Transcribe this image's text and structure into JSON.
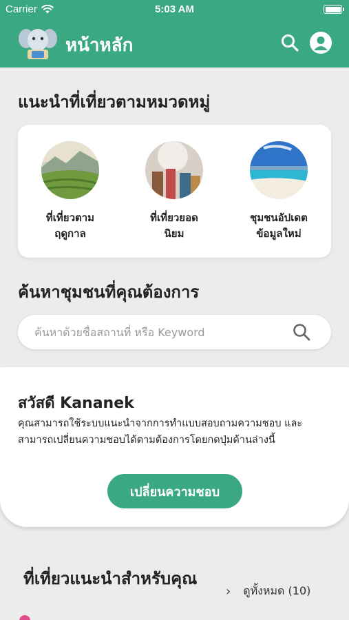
{
  "status_bar": {
    "carrier": "Carrier",
    "time": "5:03 AM"
  },
  "header": {
    "title": "หน้าหลัก",
    "logo_icon": "elephant-logo",
    "search_icon": "search-icon",
    "profile_icon": "user-icon"
  },
  "categories": {
    "title": "แนะนำที่เที่ยวตามหมวดหมู่",
    "items": [
      {
        "label_line1": "ที่เที่ยวตาม",
        "label_line2": "ฤดูกาล",
        "image": "mountain-landscape"
      },
      {
        "label_line1": "ที่เที่ยวยอด",
        "label_line2": "นิยม",
        "image": "festival-crowd"
      },
      {
        "label_line1": "ชุมชนอัปเดต",
        "label_line2": "ข้อมูลใหม่",
        "image": "beach-sea"
      }
    ]
  },
  "search": {
    "title": "ค้นหาชุมชนที่คุณต้องการ",
    "placeholder": "ค้นหาด้วยชื่อสถานที่ หรือ Keyword"
  },
  "greeting": {
    "hello": "สวัสดี Kananek",
    "description": "คุณสามารถใช้ระบบแนะนำจากการทำแบบสอบถามความชอบ และสามารถเปลี่ยนความชอบได้ตามต้องการโดยกดปุ่มด้านล่างนี้",
    "button": "เปลี่ยนความชอบ"
  },
  "recommended": {
    "title": "ที่เที่ยวแนะนำสำหรับคุณ",
    "see_all": "ดูทั้งหมด (10)"
  },
  "colors": {
    "primary": "#3aa981",
    "background": "#ececec",
    "card": "#ffffff"
  }
}
